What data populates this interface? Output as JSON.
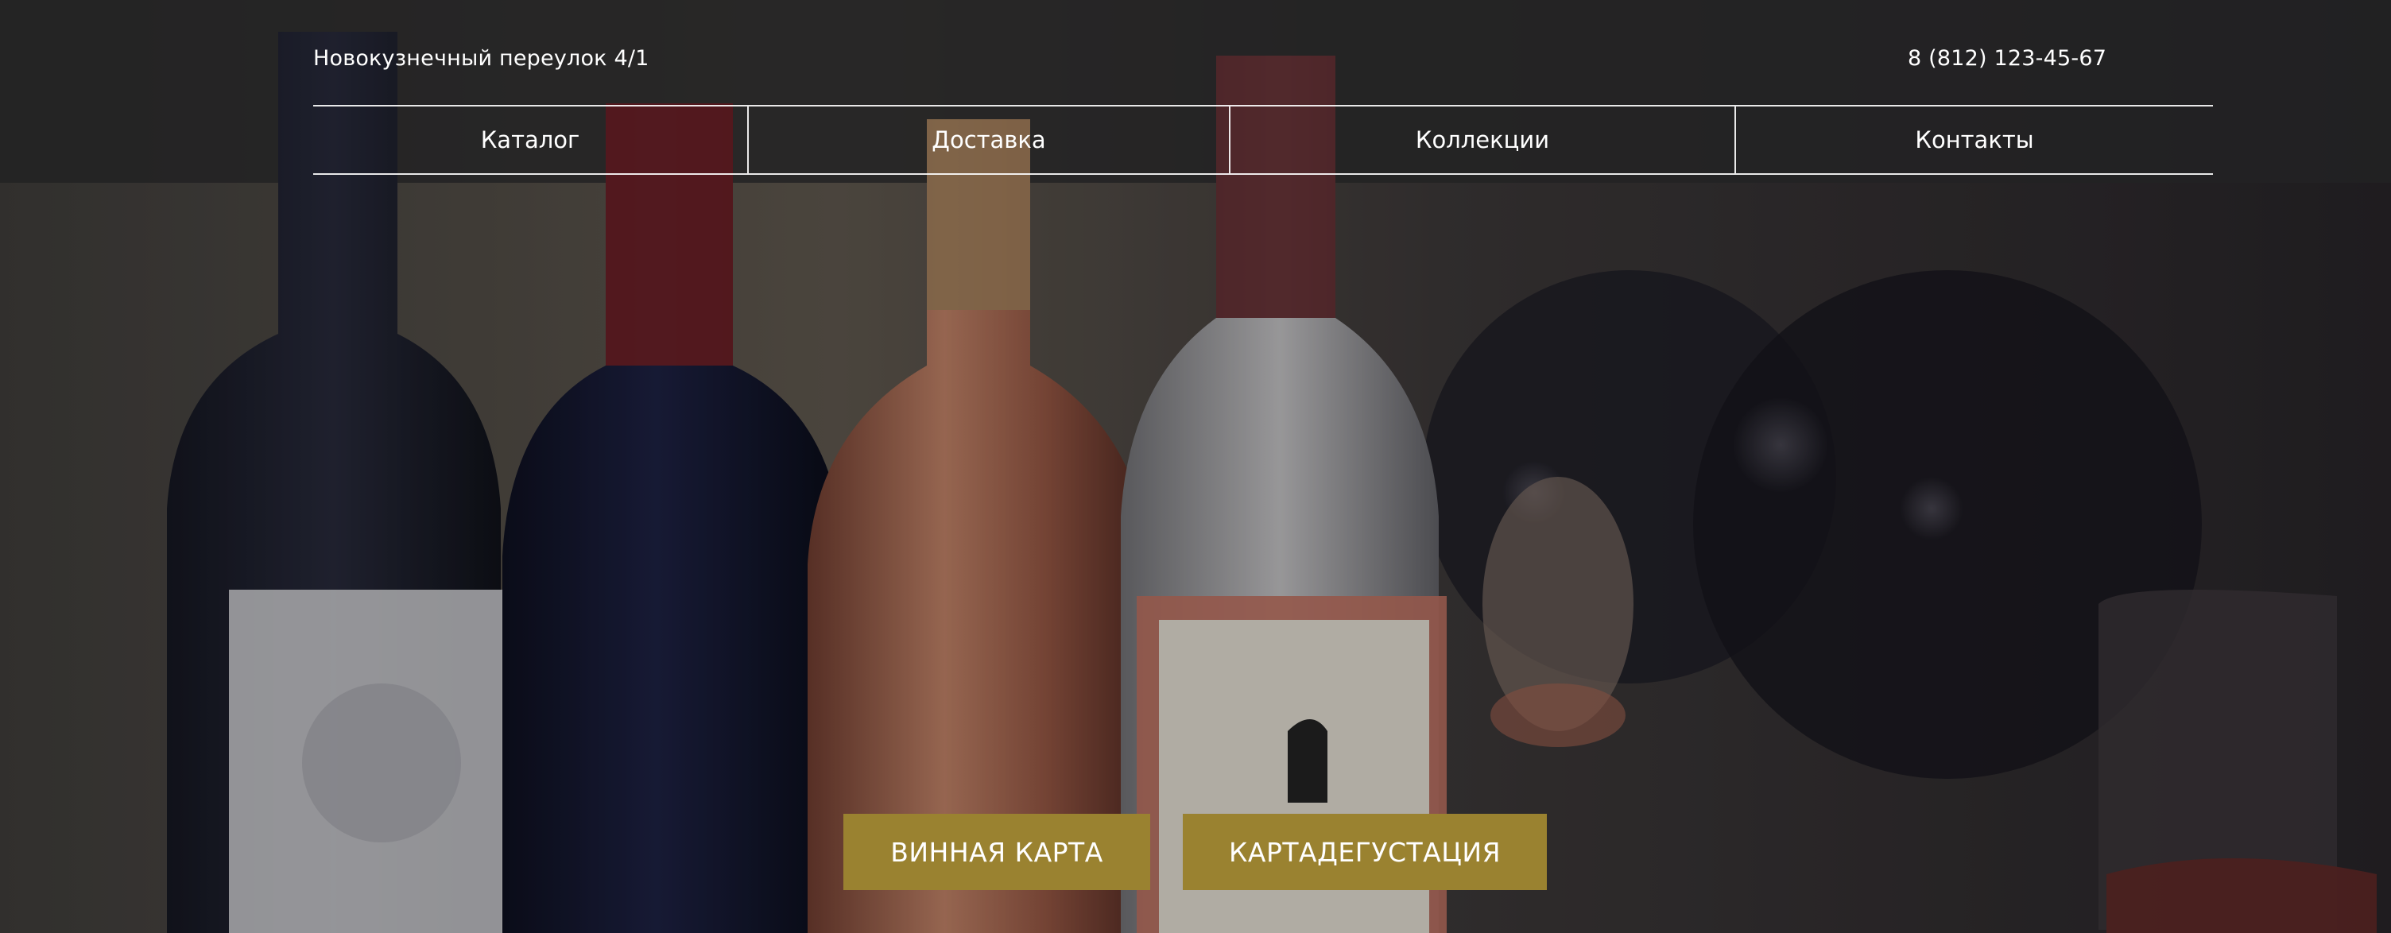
{
  "header": {
    "address": "Новокузнечный переулок 4/1",
    "phone": "8 (812) 123-45-67"
  },
  "nav": {
    "items": [
      {
        "label": "Каталог"
      },
      {
        "label": "Доставка"
      },
      {
        "label": "Коллекции"
      },
      {
        "label": "Контакты"
      }
    ]
  },
  "hero": {
    "buttons": {
      "wine_list": "ВИННАЯ КАРТА",
      "tasting_card": "КАРТАДЕГУСТАЦИЯ"
    }
  },
  "colors": {
    "accent": "#9a8230",
    "text": "#ffffff"
  },
  "icons": {
    "background": "wine-bottles-photo"
  }
}
